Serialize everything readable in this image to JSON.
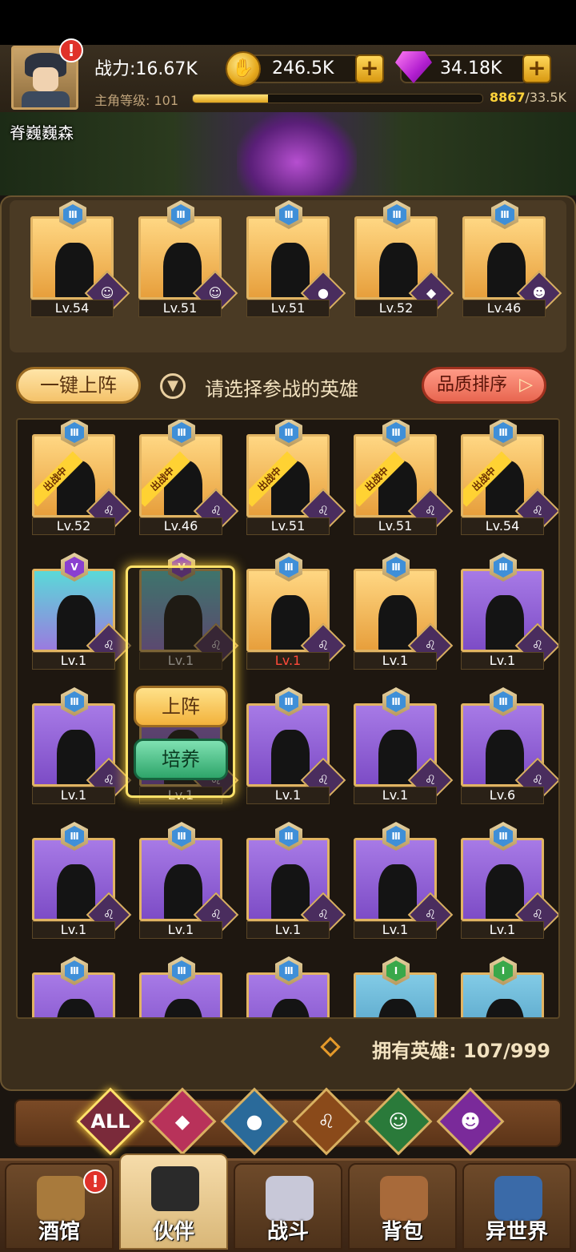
{
  "player": {
    "power": "战力:16.67K",
    "name": "脊巍巍森",
    "level_label": "主角等级: 101",
    "exp_current": "8867",
    "exp_total": "/33.5K",
    "exp_fraction": 0.26
  },
  "resources": {
    "gold": "246.5K",
    "gems": "34.18K"
  },
  "team": [
    {
      "level": "Lv.54",
      "bg": "gold",
      "rank": "Ⅲ",
      "faction": "elf"
    },
    {
      "level": "Lv.51",
      "bg": "gold",
      "rank": "Ⅲ",
      "faction": "elf"
    },
    {
      "level": "Lv.51",
      "bg": "gold",
      "rank": "Ⅲ",
      "faction": "water"
    },
    {
      "level": "Lv.52",
      "bg": "gold",
      "rank": "Ⅲ",
      "faction": "knight"
    },
    {
      "level": "Lv.46",
      "bg": "gold",
      "rank": "Ⅲ",
      "faction": "demon"
    }
  ],
  "actions": {
    "auto_deploy": "一键上阵",
    "hint": "请选择参战的英雄",
    "sort": "品质排序"
  },
  "badge_deployed": "出战中",
  "heroes": [
    {
      "level": "Lv.52",
      "bg": "gold",
      "rank": "Ⅲ",
      "deployed": true
    },
    {
      "level": "Lv.46",
      "bg": "gold",
      "rank": "Ⅲ",
      "deployed": true
    },
    {
      "level": "Lv.51",
      "bg": "gold",
      "rank": "Ⅲ",
      "deployed": true
    },
    {
      "level": "Lv.51",
      "bg": "gold",
      "rank": "Ⅲ",
      "deployed": true
    },
    {
      "level": "Lv.54",
      "bg": "gold",
      "rank": "Ⅲ",
      "deployed": true
    },
    {
      "level": "Lv.1",
      "bg": "cyan",
      "rank": "V"
    },
    {
      "level": "Lv.1",
      "bg": "cyan",
      "rank": "V"
    },
    {
      "level": "Lv.1",
      "bg": "gold",
      "rank": "Ⅲ",
      "red": true
    },
    {
      "level": "Lv.1",
      "bg": "gold",
      "rank": "Ⅲ"
    },
    {
      "level": "Lv.1",
      "bg": "purple",
      "rank": "Ⅲ"
    },
    {
      "level": "Lv.1",
      "bg": "purple",
      "rank": "Ⅲ"
    },
    {
      "level": "Lv.1",
      "bg": "purple",
      "rank": "Ⅲ"
    },
    {
      "level": "Lv.1",
      "bg": "purple",
      "rank": "Ⅲ"
    },
    {
      "level": "Lv.1",
      "bg": "purple",
      "rank": "Ⅲ"
    },
    {
      "level": "Lv.6",
      "bg": "purple",
      "rank": "Ⅲ"
    },
    {
      "level": "Lv.1",
      "bg": "purple",
      "rank": "Ⅲ"
    },
    {
      "level": "Lv.1",
      "bg": "purple",
      "rank": "Ⅲ"
    },
    {
      "level": "Lv.1",
      "bg": "purple",
      "rank": "Ⅲ"
    },
    {
      "level": "Lv.1",
      "bg": "purple",
      "rank": "Ⅲ"
    },
    {
      "level": "Lv.1",
      "bg": "purple",
      "rank": "Ⅲ"
    },
    {
      "level": "",
      "bg": "purple",
      "rank": "Ⅲ"
    },
    {
      "level": "",
      "bg": "purple",
      "rank": "Ⅲ"
    },
    {
      "level": "",
      "bg": "purple",
      "rank": "Ⅲ"
    },
    {
      "level": "",
      "bg": "blue",
      "rank": "I"
    },
    {
      "level": "",
      "bg": "blue",
      "rank": "I"
    }
  ],
  "popup": {
    "deploy": "上阵",
    "train": "培养"
  },
  "owned": "拥有英雄: 107/999",
  "filters": [
    {
      "label": "ALL",
      "icon": "all-icon"
    },
    {
      "label": "",
      "icon": "knight-faction-icon"
    },
    {
      "label": "",
      "icon": "water-faction-icon"
    },
    {
      "label": "",
      "icon": "lion-faction-icon"
    },
    {
      "label": "",
      "icon": "elf-faction-icon"
    },
    {
      "label": "",
      "icon": "demon-faction-icon"
    }
  ],
  "nav": [
    {
      "label": "酒馆",
      "icon": "tavern-icon"
    },
    {
      "label": "伙伴",
      "icon": "partner-icon"
    },
    {
      "label": "战斗",
      "icon": "battle-icon"
    },
    {
      "label": "背包",
      "icon": "backpack-icon"
    },
    {
      "label": "异世界",
      "icon": "portal-icon"
    }
  ],
  "alert_mark": "!"
}
